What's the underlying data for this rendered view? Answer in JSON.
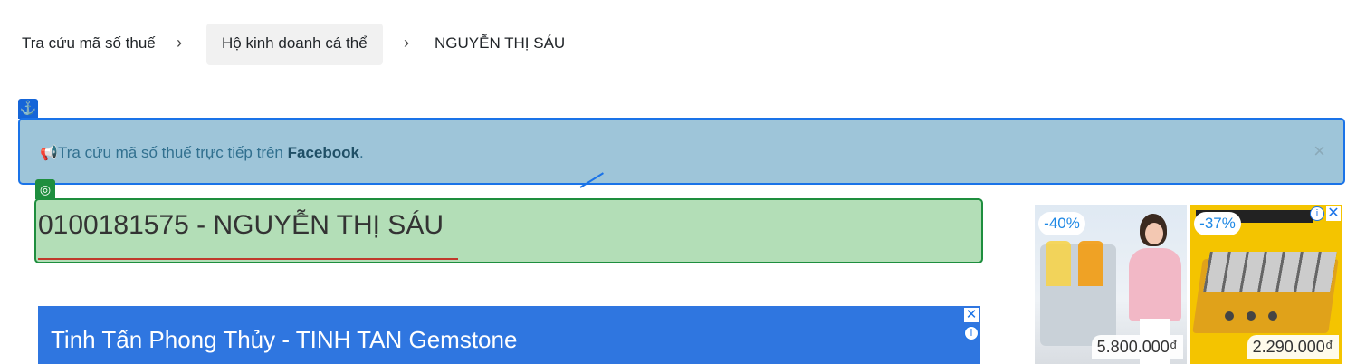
{
  "breadcrumb": {
    "items": [
      {
        "label": "Tra cứu mã số thuế"
      },
      {
        "label": "Hộ kinh doanh cá thể"
      },
      {
        "label": "NGUYỄN THỊ SÁU"
      }
    ],
    "separator": "›"
  },
  "alert": {
    "text_prefix": "Tra cứu mã số thuế trực tiếp trên ",
    "link": "Facebook",
    "text_suffix": ".",
    "close": "×",
    "icon": "megaphone-icon"
  },
  "overlay_tags": {
    "anchor_icon": "⚓",
    "target_icon": "◎"
  },
  "page_title": "0100181575 - NGUYỄN THỊ SÁU",
  "ad_banner": {
    "text": "Tinh Tấn Phong Thủy - TINH TAN Gemstone",
    "close": "✕",
    "info": "i"
  },
  "product_ads": [
    {
      "discount": "-40%",
      "price": "5.800.000₫"
    },
    {
      "discount": "-37%",
      "price": "2.290.000₫"
    }
  ],
  "adchoices": {
    "info": "i",
    "close": "✕"
  },
  "colors": {
    "alert_bg": "#9ec5d9",
    "alert_border": "#1a73e8",
    "title_bg": "#b3deb7",
    "title_border": "#1e8e3e",
    "ad_banner_bg": "#2f76e0"
  }
}
